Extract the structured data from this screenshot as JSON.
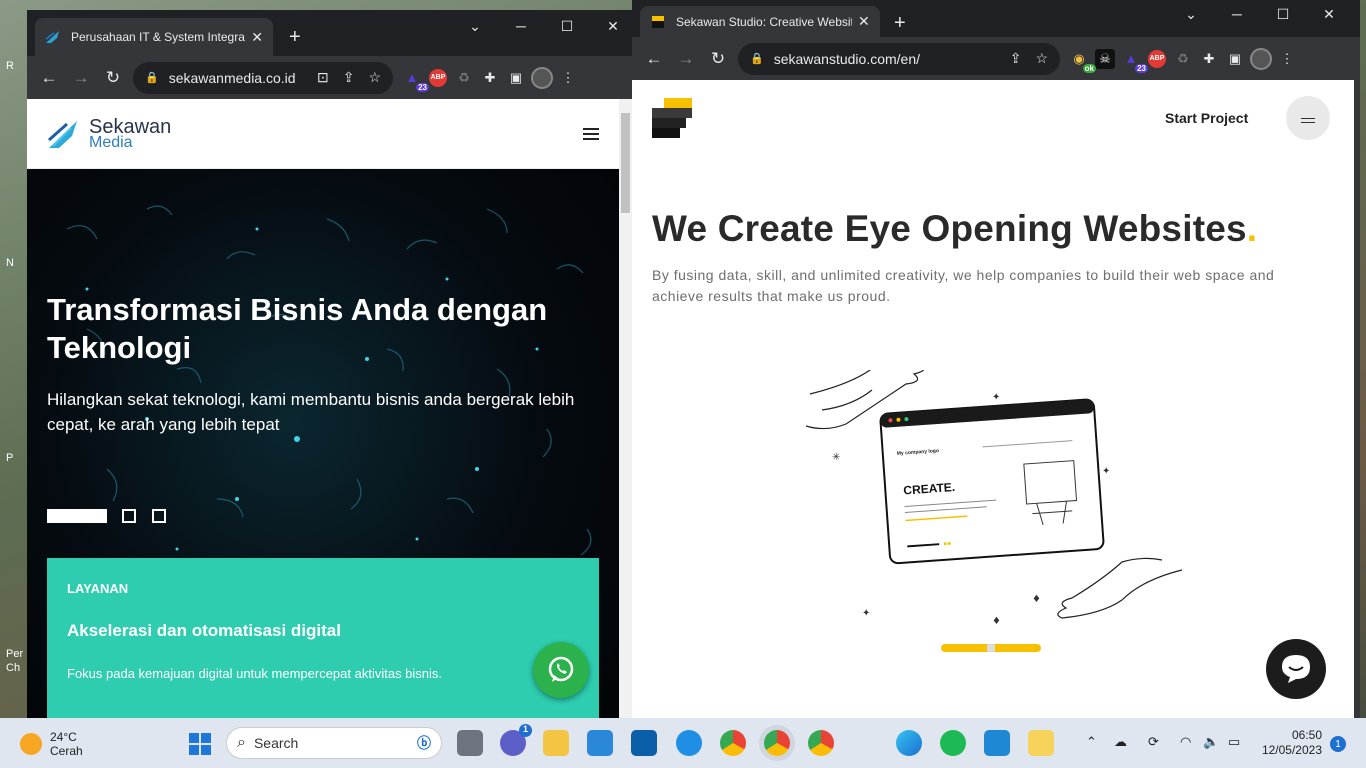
{
  "desktop": {
    "labels": [
      "R",
      "N",
      "P",
      "Per",
      "Ch"
    ]
  },
  "left_window": {
    "tab_title": "Perusahaan IT & System Integrato",
    "url": "sekawanmedia.co.id",
    "ext_badge": "23",
    "abp_label": "ABP",
    "site": {
      "logo_line1": "Sekawan",
      "logo_line2": "Media",
      "hero_title": "Transformasi Bisnis Anda dengan Teknologi",
      "hero_text": "Hilangkan sekat teknologi, kami membantu bisnis anda bergerak lebih cepat, ke arah yang lebih tepat",
      "card_kicker": "LAYANAN",
      "card_title": "Akselerasi dan otomatisasi digital",
      "card_desc": "Fokus pada kemajuan digital untuk mempercepat aktivitas bisnis."
    }
  },
  "right_window": {
    "tab_title": "Sekawan Studio: Creative Website",
    "url": "sekawanstudio.com/en/",
    "ext_badge": "23",
    "ok_label": "ok",
    "abp_label": "ABP",
    "site": {
      "start_project": "Start Project",
      "headline": "We Create Eye Opening Websites",
      "headline_dot": ".",
      "subtitle": "By fusing data, skill, and unlimited creativity, we help companies to build their web space and achieve results that make us proud.",
      "mock_brand": "My company logo",
      "mock_title": "CREATE."
    }
  },
  "taskbar": {
    "temp": "24°C",
    "weather": "Cerah",
    "search_label": "Search",
    "chat_badge": "1",
    "time": "06:50",
    "date": "12/05/2023",
    "notifications": "1"
  },
  "colors": {
    "accent_teal": "#2ecdb0",
    "accent_yellow": "#f8c100",
    "whatsapp": "#2bb24c"
  }
}
